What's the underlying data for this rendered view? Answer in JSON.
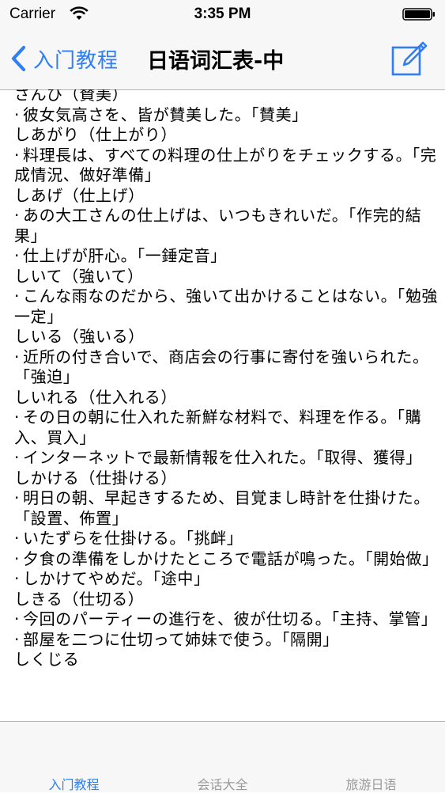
{
  "status_bar": {
    "carrier": "Carrier",
    "time": "3:35 PM"
  },
  "nav": {
    "back_label": "入门教程",
    "title": "日语词汇表-中",
    "accent_color": "#2f7ef6",
    "edit_icon": "compose-icon"
  },
  "entries": [
    {
      "kind": "word",
      "text": "さんび（賛美）"
    },
    {
      "kind": "sentence",
      "text": "彼女気高さを、皆が賛美した。「賛美」"
    },
    {
      "kind": "word",
      "text": "しあがり（仕上がり）"
    },
    {
      "kind": "sentence",
      "text": "料理長は、すべての料理の仕上がりをチェックする。「完成情況、做好準備」"
    },
    {
      "kind": "word",
      "text": "しあげ（仕上げ）"
    },
    {
      "kind": "sentence",
      "text": "あの大工さんの仕上げは、いつもきれいだ。「作完的結果」"
    },
    {
      "kind": "sentence",
      "text": "仕上げが肝心。「一錘定音」"
    },
    {
      "kind": "word",
      "text": "しいて（強いて）"
    },
    {
      "kind": "sentence",
      "text": "こんな雨なのだから、強いて出かけることはない。「勉強一定」"
    },
    {
      "kind": "word",
      "text": "しいる（強いる）"
    },
    {
      "kind": "sentence",
      "text": "近所の付き合いで、商店会の行事に寄付を強いられた。「強迫」"
    },
    {
      "kind": "word",
      "text": "しいれる（仕入れる）"
    },
    {
      "kind": "sentence",
      "text": "その日の朝に仕入れた新鮮な材料で、料理を作る。「購入、買入」"
    },
    {
      "kind": "sentence",
      "text": "インターネットで最新情報を仕入れた。「取得、獲得」"
    },
    {
      "kind": "word",
      "text": "しかける（仕掛ける）"
    },
    {
      "kind": "sentence",
      "text": "明日の朝、早起きするため、目覚まし時計を仕掛けた。「設置、佈置」"
    },
    {
      "kind": "sentence",
      "text": "いたずらを仕掛ける。「挑衅」"
    },
    {
      "kind": "sentence",
      "text": "夕食の準備をしかけたところで電話が鳴った。「開始做」"
    },
    {
      "kind": "sentence",
      "text": "しかけてやめだ。「途中」"
    },
    {
      "kind": "word",
      "text": "しきる（仕切る）"
    },
    {
      "kind": "sentence",
      "text": "今回のパーティーの進行を、彼が仕切る。「主持、掌管」"
    },
    {
      "kind": "sentence",
      "text": "部屋を二つに仕切って姉妹で使う。「隔開」"
    },
    {
      "kind": "word",
      "text": "しくじる"
    }
  ],
  "tabs": [
    {
      "label": "入门教程",
      "selected": true
    },
    {
      "label": "会话大全",
      "selected": false
    },
    {
      "label": "旅游日语",
      "selected": false
    }
  ]
}
